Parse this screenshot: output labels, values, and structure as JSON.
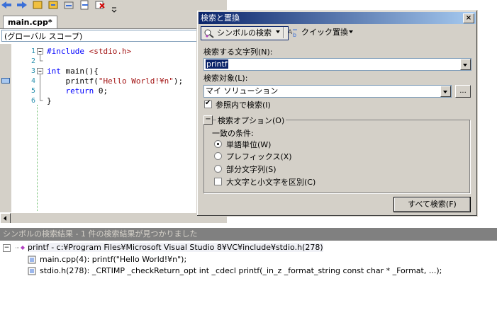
{
  "editor": {
    "tab_label": "main.cpp*",
    "scope": "(グローバル スコープ)",
    "line_numbers": [
      "1",
      "2",
      "3",
      "4",
      "5",
      "6"
    ],
    "code": {
      "l1_kw": "#include",
      "l1_rest": " <stdio.h>",
      "l3_kw": "int",
      "l3_rest": " main(){",
      "l4_a": "    printf(",
      "l4_str": "\"Hello World!¥n\"",
      "l4_b": ");",
      "l5_kw": "    return",
      "l5_rest": " 0;",
      "l6": "}"
    }
  },
  "dialog": {
    "title": "検索と置換",
    "close": "×",
    "tab_symbol": "シンボルの検索",
    "tab_quick": "クイック置換",
    "find_label": "検索する文字列(N):",
    "find_value": "printf",
    "look_in_label": "検索対象(L):",
    "look_in_value": "マイ ソリューション",
    "browse_label": "...",
    "search_refs_label": "参照内で検索(I)",
    "options_toggle": "−",
    "options_label": "検索オプション(O)",
    "match_label": "一致の条件:",
    "radio_word": "単語単位(W)",
    "radio_prefix": "プレフィックス(X)",
    "radio_substring": "部分文字列(S)",
    "match_case_label": "大文字と小文字を区別(C)",
    "find_all_button": "すべて検索(F)"
  },
  "results": {
    "title": "シンボルの検索結果 - 1 件の検索結果が見つかりました",
    "rows": [
      "printf - c:¥Program Files¥Microsoft Visual Studio 8¥VC¥include¥stdio.h(278)",
      "main.cpp(4): printf(\"Hello World!¥n\");",
      "stdio.h(278): _CRTIMP _checkReturn_opt int _cdecl printf(_in_z _format_string const char * _Format, ...);"
    ]
  },
  "colors": {
    "accent": "#0a246a",
    "chrome": "#d4d0c8",
    "keyword": "#0000ff",
    "string": "#a31515"
  }
}
